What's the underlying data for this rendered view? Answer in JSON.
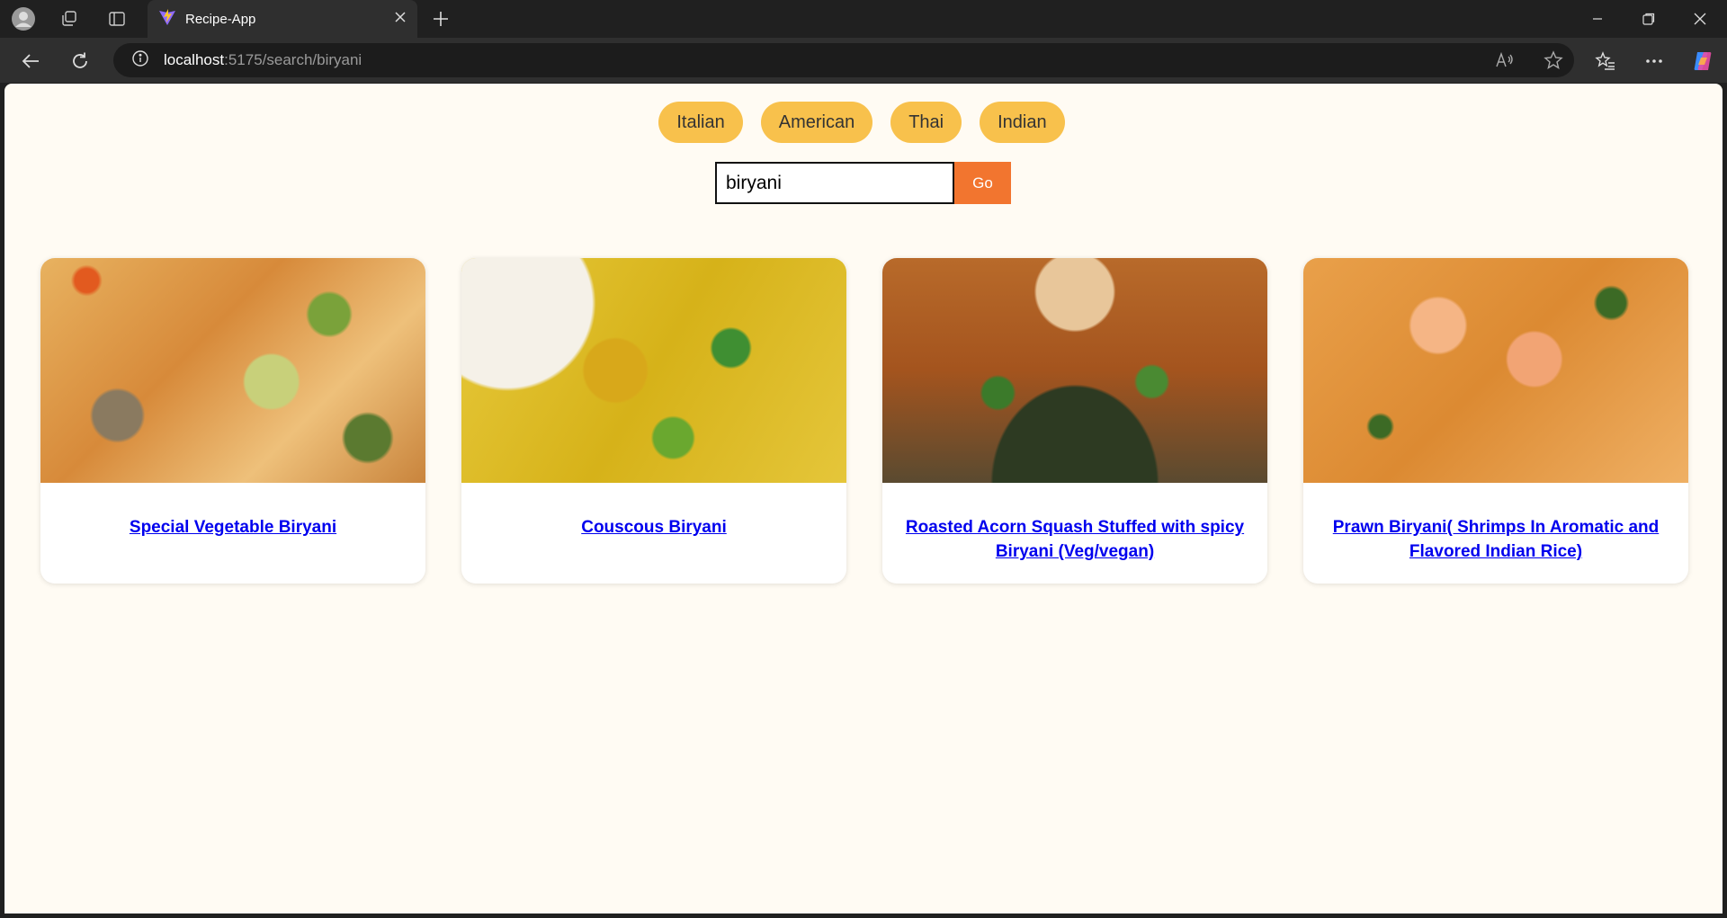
{
  "browser": {
    "tab_title": "Recipe-App",
    "url_host": "localhost",
    "url_path": ":5175/search/biryani"
  },
  "cuisines": [
    "Italian",
    "American",
    "Thai",
    "Indian"
  ],
  "search": {
    "value": "biryani",
    "go_label": "Go"
  },
  "recipes": [
    {
      "title": "Special Vegetable Biryani"
    },
    {
      "title": "Couscous Biryani"
    },
    {
      "title": "Roasted Acorn Squash Stuffed with spicy Biryani (Veg/vegan)"
    },
    {
      "title": "Prawn Biryani( Shrimps In Aromatic and Flavored Indian Rice)"
    }
  ]
}
